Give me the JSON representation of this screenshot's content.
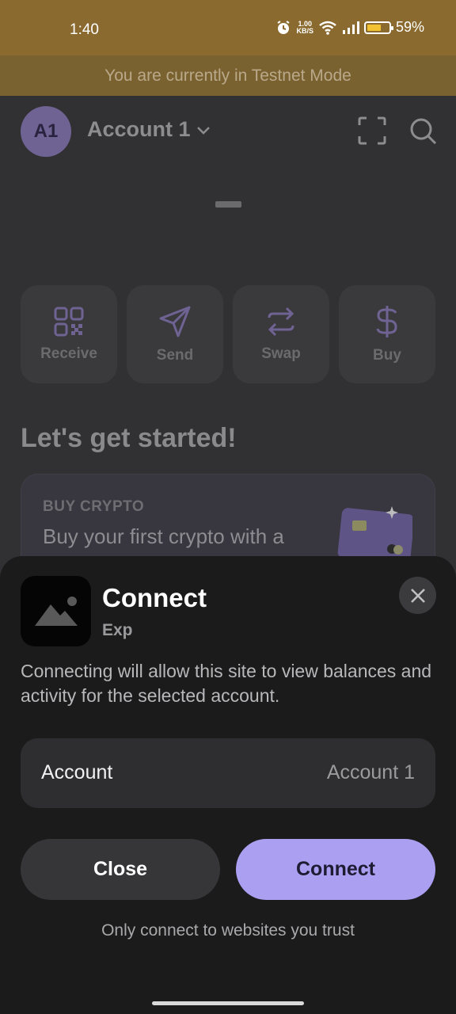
{
  "status_bar": {
    "time": "1:40",
    "net_speed_value": "1.00",
    "net_speed_unit": "KB/S",
    "battery": "59%"
  },
  "banner": {
    "text": "You are currently in Testnet Mode"
  },
  "header": {
    "avatar": "A1",
    "account_name": "Account 1"
  },
  "balance": {
    "value": "–"
  },
  "actions": [
    {
      "label": "Receive",
      "icon": "qr-code-icon"
    },
    {
      "label": "Send",
      "icon": "send-icon"
    },
    {
      "label": "Swap",
      "icon": "swap-icon"
    },
    {
      "label": "Buy",
      "icon": "dollar-icon"
    }
  ],
  "onboarding": {
    "heading": "Let's get started!",
    "card_eyebrow": "BUY CRYPTO",
    "card_text": "Buy your first crypto with a"
  },
  "sheet": {
    "title": "Connect",
    "site_name": "Exp",
    "description": "Connecting will allow this site to view balances and activity for the selected account.",
    "account_label": "Account",
    "account_value": "Account 1",
    "close_label": "Close",
    "connect_label": "Connect",
    "footer": "Only connect to websites you trust"
  },
  "colors": {
    "testnet_banner": "#7a6130",
    "accent": "#ab9ff2",
    "sheet_bg": "#1b1b1c"
  }
}
